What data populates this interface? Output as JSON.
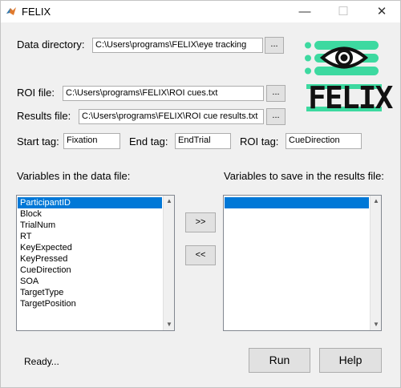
{
  "window": {
    "title": "FELIX",
    "minimize_glyph": "—",
    "maximize_glyph": "☐",
    "close_glyph": "✕"
  },
  "fields": {
    "data_directory": {
      "label": "Data directory:",
      "value": "C:\\Users\\programs\\FELIX\\eye tracking",
      "browse": "..."
    },
    "roi_file": {
      "label": "ROI file:",
      "value": "C:\\Users\\programs\\FELIX\\ROI cues.txt",
      "browse": "..."
    },
    "results_file": {
      "label": "Results file:",
      "value": "C:\\Users\\programs\\FELIX\\ROI cue results.txt",
      "browse": "..."
    },
    "start_tag": {
      "label": "Start tag:",
      "value": "Fixation"
    },
    "end_tag": {
      "label": "End tag:",
      "value": "EndTrial"
    },
    "roi_tag": {
      "label": "ROI tag:",
      "value": "CueDirection"
    }
  },
  "logo": {
    "text": "FELIX",
    "accent_color": "#3dd9a0"
  },
  "lists": {
    "variables_label": "Variables in the data file:",
    "save_label": "Variables to save in the results file:",
    "variables": [
      "ParticipantID",
      "Block",
      "TrialNum",
      "RT",
      "KeyExpected",
      "KeyPressed",
      "CueDirection",
      "SOA",
      "TargetType",
      "TargetPosition"
    ],
    "selected_index": 0
  },
  "buttons": {
    "add": ">>",
    "remove": "<<",
    "run": "Run",
    "help": "Help"
  },
  "status": "Ready...",
  "colors": {
    "selection": "#0078d7",
    "window_bg": "#f0f0f0"
  }
}
